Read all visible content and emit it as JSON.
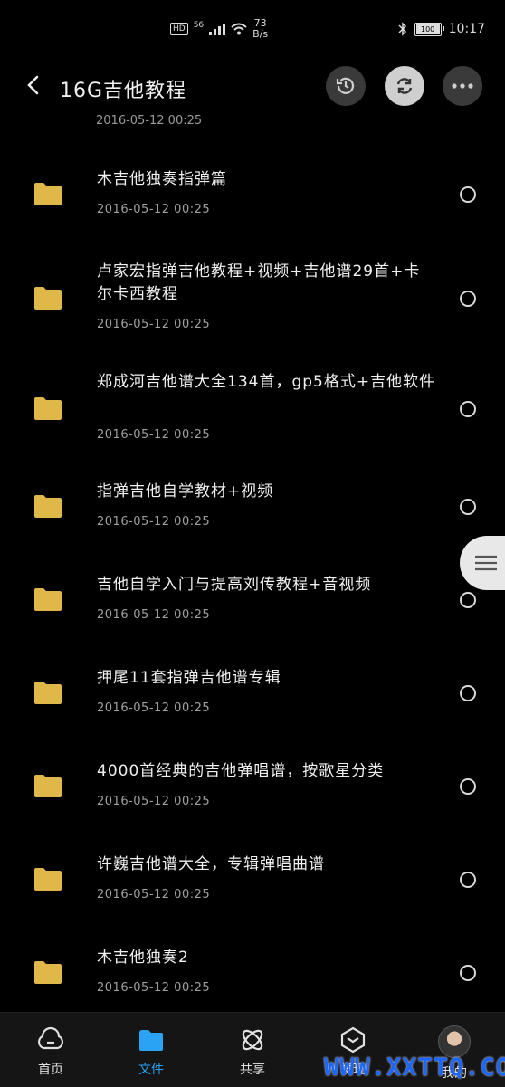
{
  "status_bar": {
    "hd": "HD",
    "network": "56",
    "speed_value": "73",
    "speed_unit": "B/s",
    "battery": "100",
    "time": "10:17"
  },
  "header": {
    "title": "16G吉他教程"
  },
  "list": {
    "partial_date": "2016-05-12  00:25",
    "items": [
      {
        "name": "木吉他独奏指弹篇",
        "date": "2016-05-12  00:25"
      },
      {
        "name": "卢家宏指弹吉他教程+视频+吉他谱29首+卡尔卡西教程",
        "date": "2016-05-12  00:25"
      },
      {
        "name": "郑成河吉他谱大全134首，gp5格式+吉他软件",
        "date": "2016-05-12  00:25"
      },
      {
        "name": "指弹吉他自学教材+视频",
        "date": "2016-05-12  00:25"
      },
      {
        "name": "吉他自学入门与提高刘传教程+音视频",
        "date": "2016-05-12  00:25"
      },
      {
        "name": "押尾11套指弹吉他谱专辑",
        "date": "2016-05-12  00:25"
      },
      {
        "name": "4000首经典的吉他弹唱谱，按歌星分类",
        "date": "2016-05-12  00:25"
      },
      {
        "name": "许巍吉他谱大全，专辑弹唱曲谱",
        "date": "2016-05-12  00:25"
      },
      {
        "name": "木吉他独奏2",
        "date": "2016-05-12  00:25"
      }
    ]
  },
  "bottom_nav": {
    "items": [
      {
        "label": "首页"
      },
      {
        "label": "文件"
      },
      {
        "label": "共享"
      },
      {
        "label": "发现"
      },
      {
        "label": "我的"
      }
    ]
  },
  "watermark": "WWW.XXTTQ.COM",
  "colors": {
    "accent": "#2aa3f5",
    "folder": "#e0b84a",
    "background": "#000000"
  }
}
